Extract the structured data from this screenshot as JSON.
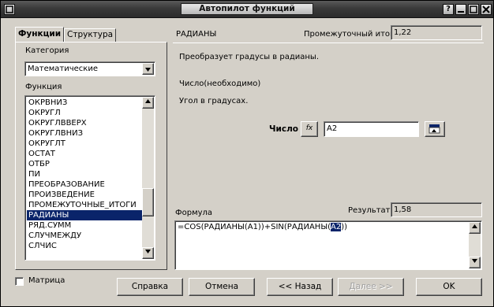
{
  "window": {
    "title": "Автопилот функций"
  },
  "tabs": [
    {
      "label": "Функции",
      "active": true
    },
    {
      "label": "Структура",
      "active": false
    }
  ],
  "left": {
    "category_label": "Категория",
    "category_value": "Математические",
    "function_label": "Функция",
    "functions": [
      "ОКРВНИЗ",
      "ОКРУГЛ",
      "ОКРУГЛВВЕРХ",
      "ОКРУГЛВНИЗ",
      "ОКРУГЛТ",
      "ОСТАТ",
      "ОТБР",
      "ПИ",
      "ПРЕОБРАЗОВАНИЕ",
      "ПРОИЗВЕДЕНИЕ",
      "ПРОМЕЖУТОЧНЫЕ_ИТОГИ",
      "РАДИАНЫ",
      "РЯД.СУММ",
      "СЛУЧМЕЖДУ",
      "СЛЧИС"
    ],
    "selected_function": "РАДИАНЫ"
  },
  "right": {
    "function_name": "РАДИАНЫ",
    "subtotal_label": "Промежуточный итог",
    "subtotal_value": "1,22",
    "description": "Преобразует градусы в радианы.",
    "arg_info": "Число(необходимо)",
    "arg_description": "Угол в градусах.",
    "arg_label": "Число",
    "arg_fx": "fx",
    "arg_value": "A2",
    "formula_label": "Формула",
    "result_label": "Результат",
    "result_value": "1,58",
    "formula_before": "=COS(РАДИАНЫ(A1))+SIN(РАДИАНЫ(",
    "formula_selected": "A2",
    "formula_after": "))"
  },
  "footer": {
    "matrix_label": "Матрица",
    "help": "Справка",
    "cancel": "Отмена",
    "back": "<< Назад",
    "next": "Далее >>",
    "ok": "OK"
  }
}
